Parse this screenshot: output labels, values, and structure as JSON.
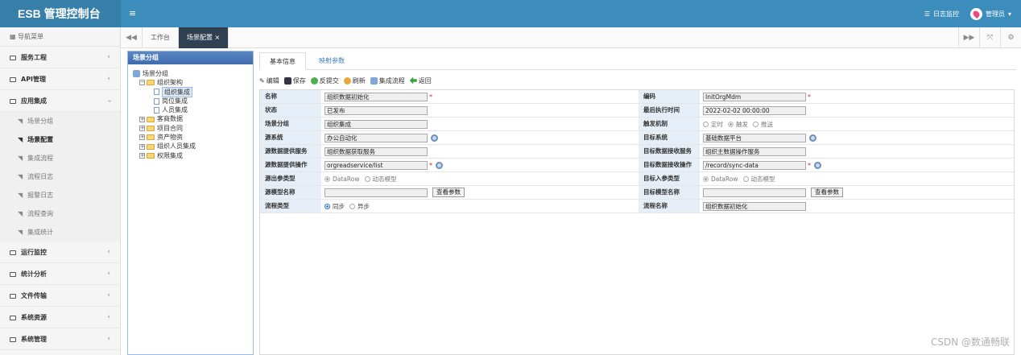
{
  "header": {
    "logo": "ESB 管理控制台",
    "menu_toggle": "≡",
    "log_monitor": "日志监控",
    "user": "管理员"
  },
  "sidebar": {
    "title": "导航菜单",
    "items_top": [
      {
        "label": "服务工程",
        "arrow": "‹"
      },
      {
        "label": "API管理",
        "arrow": "‹"
      },
      {
        "label": "应用集成",
        "arrow": "›"
      }
    ],
    "sub_items": [
      {
        "label": "场景分组"
      },
      {
        "label": "场景配置",
        "active": true
      },
      {
        "label": "集成流程"
      },
      {
        "label": "流程日志"
      },
      {
        "label": "报警日志"
      },
      {
        "label": "流程查询"
      },
      {
        "label": "集成统计"
      }
    ],
    "items_bottom": [
      {
        "label": "运行监控",
        "arrow": "‹"
      },
      {
        "label": "统计分析",
        "arrow": "‹"
      },
      {
        "label": "文件传输",
        "arrow": "‹"
      },
      {
        "label": "系统资源",
        "arrow": "‹"
      },
      {
        "label": "系统管理",
        "arrow": "‹"
      }
    ]
  },
  "tabs": {
    "items": [
      {
        "label": "工作台"
      },
      {
        "label": "场景配置",
        "close": "×"
      }
    ]
  },
  "tree": {
    "title": "场景分组",
    "root": "场景分组",
    "nodes": [
      {
        "label": "组织架构",
        "level": 1,
        "type": "folder",
        "toggle": "−"
      },
      {
        "label": "组织集成",
        "level": 2,
        "type": "doc",
        "selected": true
      },
      {
        "label": "岗位集成",
        "level": 2,
        "type": "doc"
      },
      {
        "label": "人员集成",
        "level": 2,
        "type": "doc"
      },
      {
        "label": "客商数据",
        "level": 1,
        "type": "folder",
        "toggle": "+"
      },
      {
        "label": "项目合同",
        "level": 1,
        "type": "folder",
        "toggle": "+"
      },
      {
        "label": "资产物资",
        "level": 1,
        "type": "folder",
        "toggle": "+"
      },
      {
        "label": "组织人员集成",
        "level": 1,
        "type": "folder",
        "toggle": "+"
      },
      {
        "label": "权限集成",
        "level": 1,
        "type": "folder",
        "toggle": "+"
      }
    ]
  },
  "content": {
    "tabs": [
      "基本信息",
      "映射参数"
    ],
    "toolbar": [
      "编辑",
      "保存",
      "反提交",
      "刷新",
      "集成流程",
      "返回"
    ],
    "form": {
      "name_label": "名称",
      "name_value": "组织数据初始化",
      "code_label": "编码",
      "code_value": "InitOrgMdm",
      "status_label": "状态",
      "status_value": "已发布",
      "last_exec_label": "最后执行时间",
      "last_exec_value": "2022-02-02 00:00:00",
      "group_label": "场景分组",
      "group_value": "组织集成",
      "trigger_label": "触发机制",
      "trigger_options": [
        "定时",
        "触发",
        "推送"
      ],
      "src_sys_label": "源系统",
      "src_sys_value": "办公自动化",
      "tgt_sys_label": "目标系统",
      "tgt_sys_value": "基础数据平台",
      "src_svc_label": "源数据提供服务",
      "src_svc_value": "组织数据获取服务",
      "tgt_svc_label": "目标数据接收服务",
      "tgt_svc_value": "组织主数据操作服务",
      "src_op_label": "源数据提供操作",
      "src_op_value": "orgreadservice/list",
      "tgt_op_label": "目标数据接收操作",
      "tgt_op_value": "/record/sync-data",
      "out_type_label": "源出参类型",
      "in_type_label": "目标入参类型",
      "param_type_options": [
        "DataRow",
        "动态模型"
      ],
      "src_model_label": "源模型名称",
      "tgt_model_label": "目标模型名称",
      "view_params_btn": "查看参数",
      "flow_type_label": "流程类型",
      "flow_type_options": [
        "同步",
        "异步"
      ],
      "flow_name_label": "流程名称",
      "flow_name_value": "组织数据初始化",
      "required_mark": "*"
    }
  },
  "watermark": "CSDN @数通畅联",
  "colors": {
    "header": "#3c8dbc",
    "logo_bg": "#367fa9",
    "active_tab": "#2f4050",
    "label_bg": "#e6eef8"
  }
}
